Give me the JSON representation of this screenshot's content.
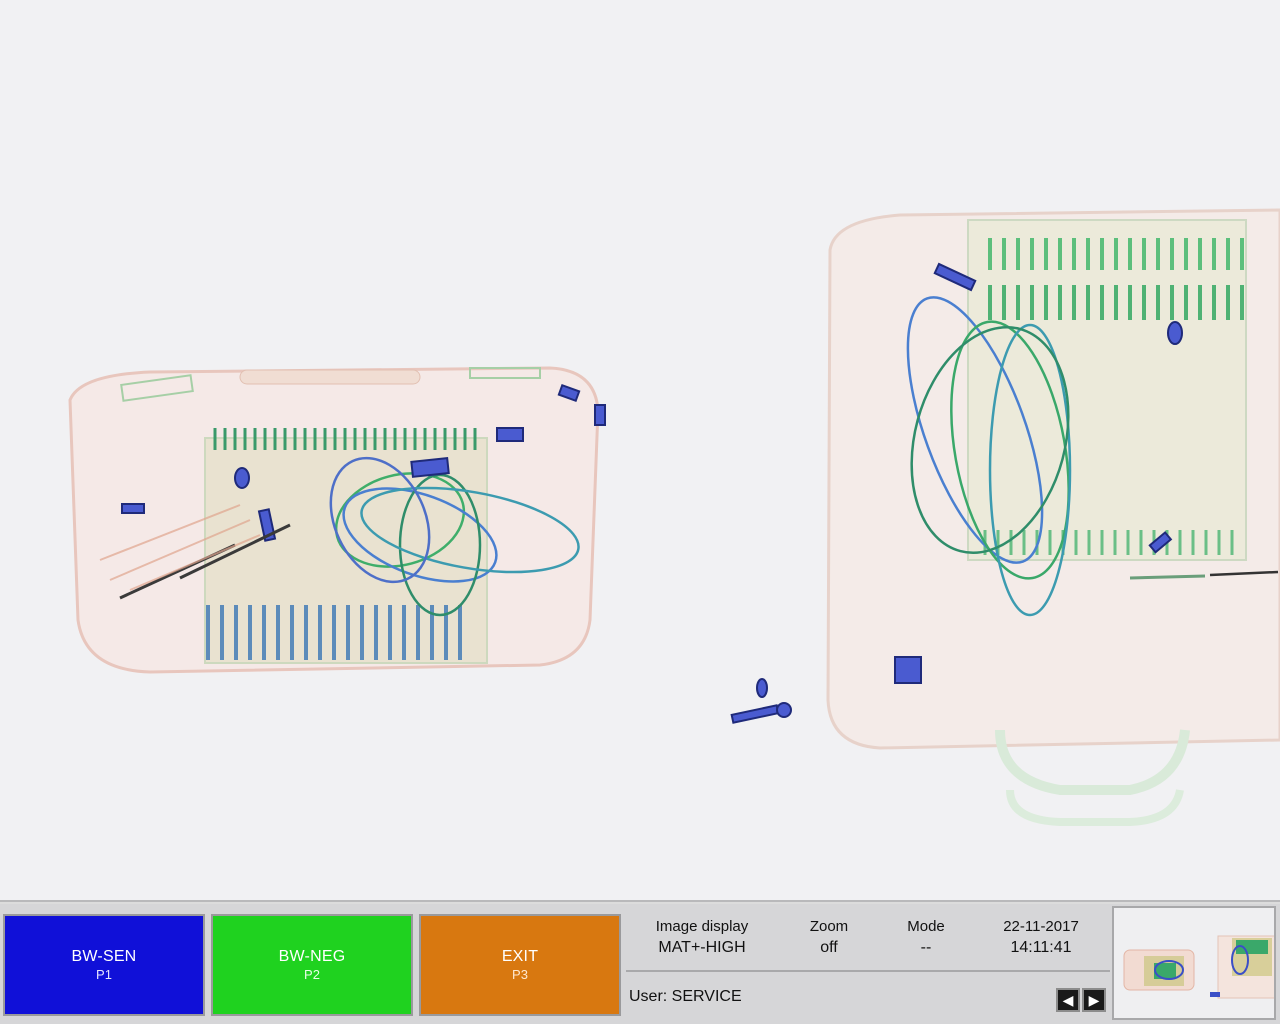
{
  "function_keys": [
    {
      "label": "BW-SEN",
      "key": "P1",
      "color": "#1010d8"
    },
    {
      "label": "BW-NEG",
      "key": "P2",
      "color": "#1fd21f"
    },
    {
      "label": "EXIT",
      "key": "P3",
      "color": "#d87810"
    }
  ],
  "status": {
    "image_display_label": "Image display",
    "image_display_value": "MAT+-HIGH",
    "zoom_label": "Zoom",
    "zoom_value": "off",
    "mode_label": "Mode",
    "mode_value": "--",
    "date": "22-11-2017",
    "time": "14:11:41",
    "user_line": "User: SERVICE"
  },
  "nav": {
    "prev_icon": "left-arrow-icon",
    "next_icon": "right-arrow-icon",
    "prev_glyph": "◀",
    "next_glyph": "▶"
  },
  "scan": {
    "colors": {
      "organic": "#e0a58e",
      "inorganic": "#3ca860",
      "metal": "#3b4fc7"
    }
  }
}
